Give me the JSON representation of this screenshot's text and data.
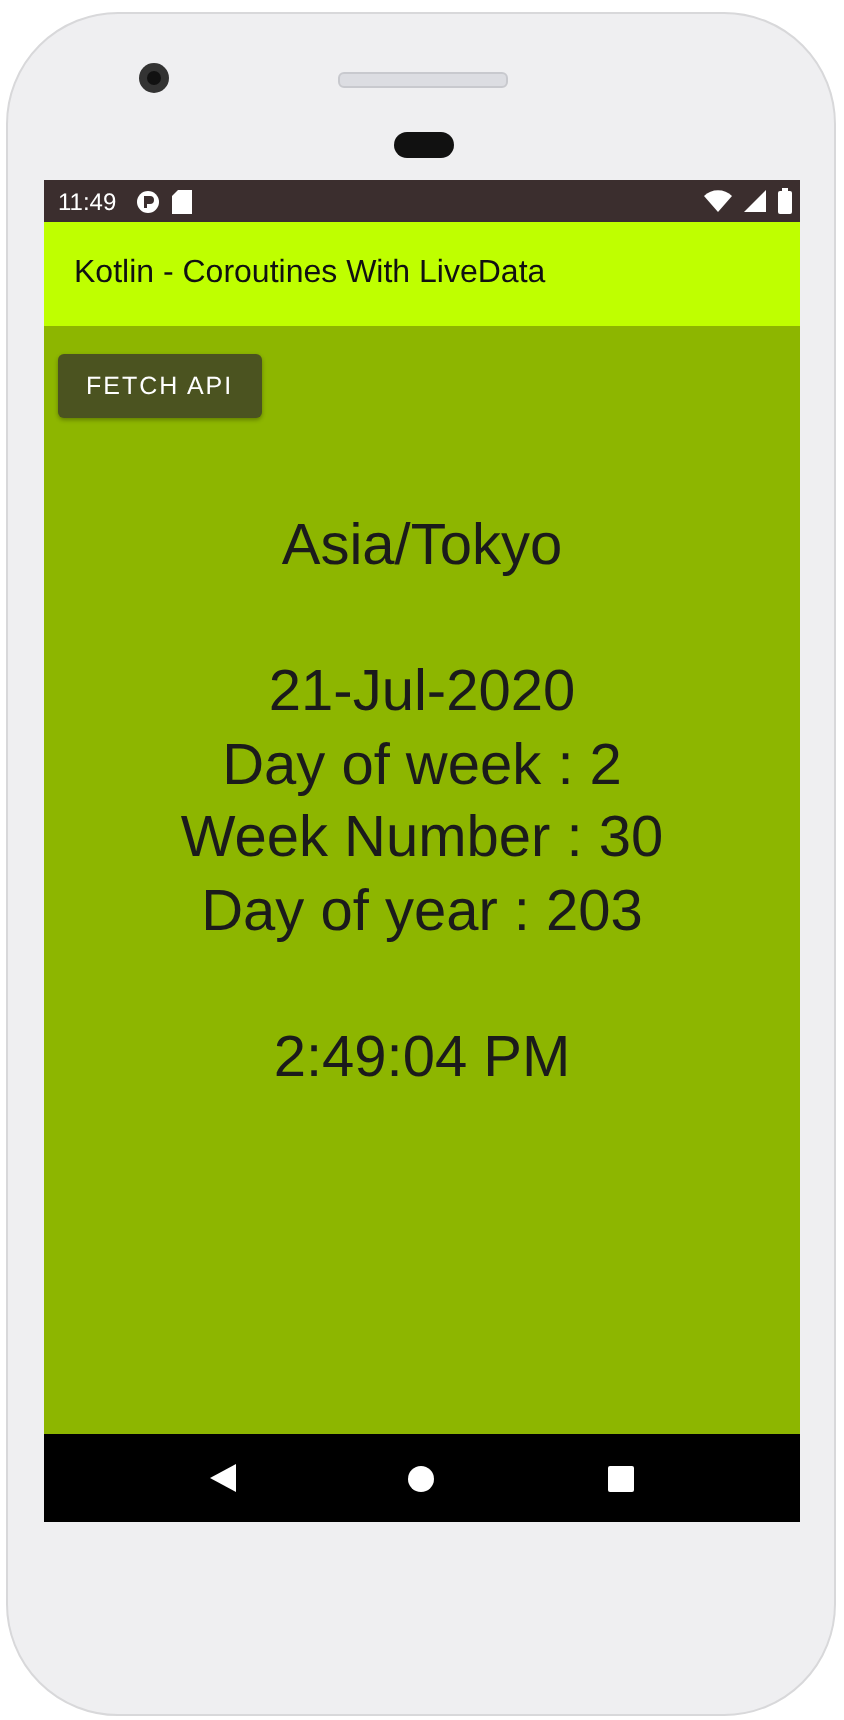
{
  "status_bar": {
    "time": "11:49"
  },
  "app_bar": {
    "title": "Kotlin - Coroutines With LiveData"
  },
  "fetch_button": {
    "label": "FETCH API"
  },
  "result": {
    "zone": "Asia/Tokyo",
    "date_lines": [
      "21-Jul-2020",
      "Day of week : 2",
      "Week Number : 30",
      "Day of year : 203"
    ],
    "time": "2:49:04 PM"
  }
}
